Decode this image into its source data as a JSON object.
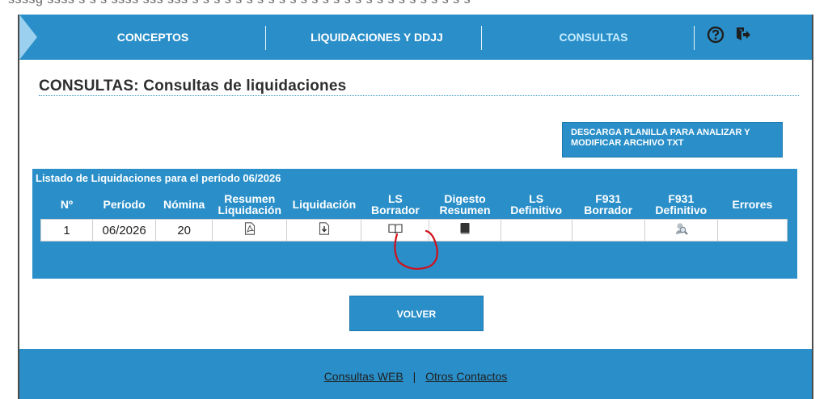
{
  "top_strip_text": "ssssg ssss s s s ssss sss sss s s s s s s s s s s s s s s s s s s s s s s s s s s",
  "nav": {
    "items": [
      {
        "label": "CONCEPTOS",
        "active": false
      },
      {
        "label": "LIQUIDACIONES Y DDJJ",
        "active": false
      },
      {
        "label": "CONSULTAS",
        "active": true
      }
    ],
    "icons": [
      "help-icon",
      "logout-icon"
    ]
  },
  "page": {
    "title": "CONSULTAS: Consultas de liquidaciones",
    "download_button": "DESCARGA PLANILLA PARA ANALIZAR Y MODIFICAR ARCHIVO TXT"
  },
  "list": {
    "caption": "Listado de Liquidaciones para el período 06/2026",
    "columns": [
      "Nº",
      "Período",
      "Nómina",
      "Resumen Liquidación",
      "Liquidación",
      "LS Borrador",
      "Digesto Resumen",
      "LS Definitivo",
      "F931 Borrador",
      "F931 Definitivo",
      "Errores"
    ],
    "rows": [
      {
        "numero": "1",
        "periodo": "06/2026",
        "nomina": "20",
        "resumen_liquidacion_icon": "pdf-icon",
        "liquidacion_icon": "download-file-icon",
        "ls_borrador_icon": "open-book-icon",
        "digesto_resumen_icon": "book-icon",
        "ls_definitivo": "",
        "f931_borrador": "",
        "f931_definitivo_icon": "search-person-icon",
        "errores": ""
      }
    ]
  },
  "volver_label": "VOLVER",
  "footer": {
    "link1": "Consultas WEB",
    "separator": "|",
    "link2": "Otros Contactos"
  },
  "colors": {
    "brand_blue": "#2a8fc9",
    "annotation_red": "#d0101a"
  }
}
